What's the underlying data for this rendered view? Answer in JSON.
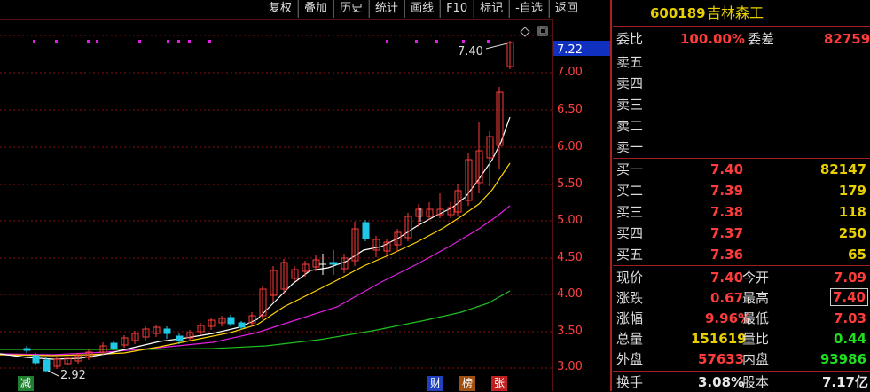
{
  "toolbar": [
    "复权",
    "叠加",
    "历史",
    "统计",
    "画线",
    "F10",
    "标记",
    "-自选",
    "返回"
  ],
  "stock": {
    "code": "600189",
    "name": "吉林森工"
  },
  "chart_labels": {
    "price_max_label": "7.40",
    "price_min_label": "2.92",
    "current_price_tag": "7.22",
    "y_ticks": [
      "7.00",
      "6.50",
      "6.00",
      "5.50",
      "5.00",
      "4.50",
      "4.00",
      "3.50",
      "3.00"
    ],
    "bottom_badges": [
      "减",
      "财",
      "榜",
      "张"
    ]
  },
  "colors": {
    "up": "#ff3c3c",
    "down": "#20c8e8",
    "ma5": "#ffffff",
    "ma10": "#ffd400",
    "ma20": "#e020e0",
    "ma60": "#20c020",
    "accent": "#b02020"
  },
  "weibi": {
    "label1": "委比",
    "value1": "100.00%",
    "label2": "委差",
    "value2": "82759"
  },
  "sell": [
    {
      "label": "卖五",
      "price": "",
      "vol": ""
    },
    {
      "label": "卖四",
      "price": "",
      "vol": ""
    },
    {
      "label": "卖三",
      "price": "",
      "vol": ""
    },
    {
      "label": "卖二",
      "price": "",
      "vol": ""
    },
    {
      "label": "卖一",
      "price": "",
      "vol": ""
    }
  ],
  "buy": [
    {
      "label": "买一",
      "price": "7.40",
      "vol": "82147"
    },
    {
      "label": "买二",
      "price": "7.39",
      "vol": "179"
    },
    {
      "label": "买三",
      "price": "7.38",
      "vol": "118"
    },
    {
      "label": "买四",
      "price": "7.37",
      "vol": "250"
    },
    {
      "label": "买五",
      "price": "7.36",
      "vol": "65"
    }
  ],
  "stats": [
    {
      "l1": "现价",
      "v1": "7.40",
      "l2": "今开",
      "v2": "7.09"
    },
    {
      "l1": "涨跌",
      "v1": "0.67",
      "l2": "最高",
      "v2": "7.40"
    },
    {
      "l1": "涨幅",
      "v1": "9.96%",
      "l2": "最低",
      "v2": "7.03"
    },
    {
      "l1": "总量",
      "v1": "151619",
      "l2": "量比",
      "v2": "0.44"
    },
    {
      "l1": "外盘",
      "v1": "57633",
      "l2": "内盘",
      "v2": "93986"
    },
    {
      "l1": "换手",
      "v1": "3.08%",
      "l2": "股本",
      "v2": "7.17亿"
    }
  ]
}
